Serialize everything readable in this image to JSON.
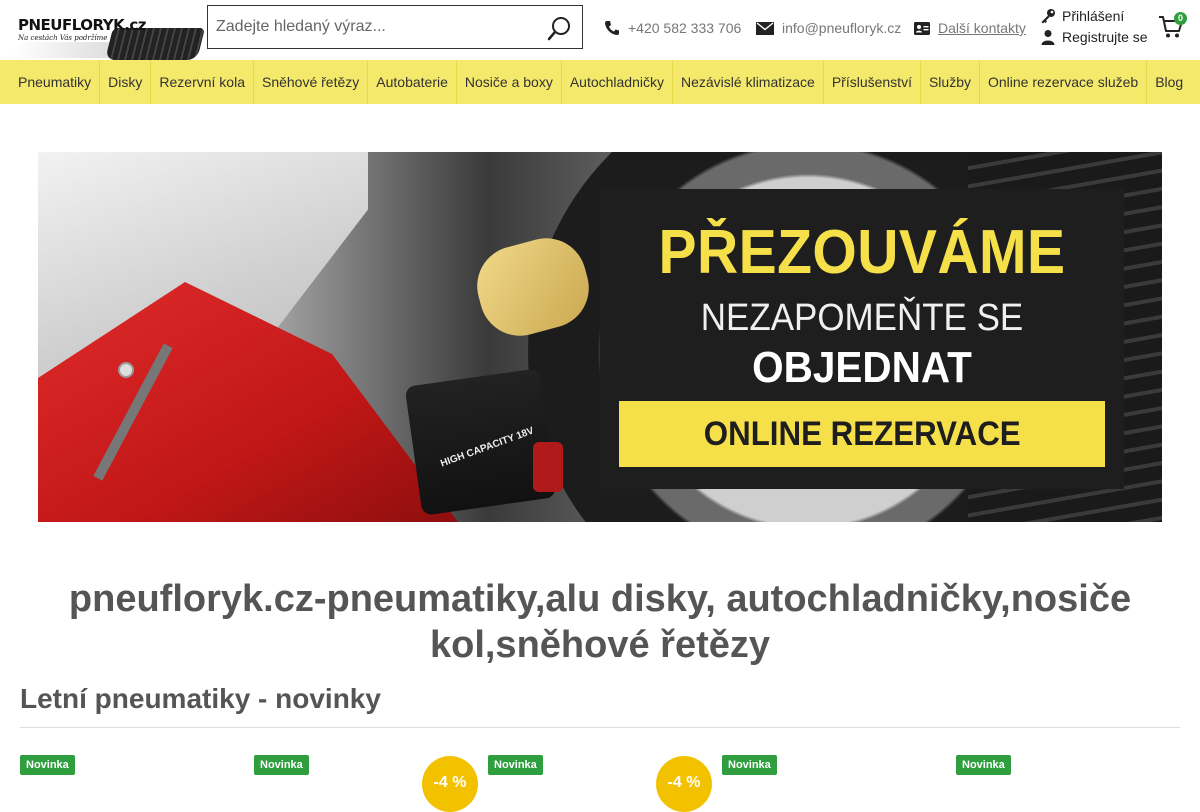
{
  "logo": {
    "brand": "PNEUFLORYK.cz",
    "tagline": "Na cestách Vás podržíme"
  },
  "search": {
    "placeholder": "Zadejte hledaný výraz..."
  },
  "contacts": {
    "phone": "+420 582 333 706",
    "email": "info@pneufloryk.cz",
    "more": "Další kontakty"
  },
  "account": {
    "login": "Přihlášení",
    "register": "Registrujte se"
  },
  "cart": {
    "count": "0",
    "badge_color": "#2e9e3e"
  },
  "nav": {
    "items": [
      {
        "label": "Pneumatiky"
      },
      {
        "label": "Disky"
      },
      {
        "label": "Rezervní kola"
      },
      {
        "label": "Sněhové řetězy"
      },
      {
        "label": "Autobaterie"
      },
      {
        "label": "Nosiče a boxy"
      },
      {
        "label": "Autochladničky"
      },
      {
        "label": "Nezávislé klimatizace"
      },
      {
        "label": "Příslušenství"
      },
      {
        "label": "Služby"
      },
      {
        "label": "Online rezervace služeb"
      },
      {
        "label": "Blog"
      }
    ],
    "bg_color": "#f4e96b"
  },
  "banner": {
    "title": "PŘEZOUVÁME",
    "line2": "NEZAPOMEŇTE SE",
    "line3": "OBJEDNAT",
    "cta": "ONLINE REZERVACE",
    "drill_label": "HIGH CAPACITY 18V",
    "accent_color": "#f6e04a"
  },
  "main": {
    "title": "pneufloryk.cz-pneumatiky,alu disky, autochladničky,nosiče kol,sněhové řetězy",
    "section_title": "Letní pneumatiky - novinky"
  },
  "products": {
    "badges": [
      "Novinka",
      "Novinka",
      "Novinka",
      "Novinka",
      "Novinka"
    ],
    "discounts": [
      "-4 %",
      "-4 %"
    ]
  }
}
